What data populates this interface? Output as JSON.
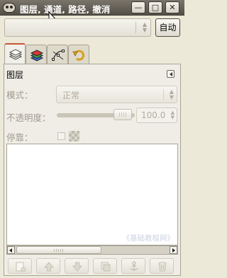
{
  "window": {
    "title": "图层, 通道, 路径, 撤消",
    "minimize_icon": "minimize-icon",
    "maximize_icon": "maximize-icon",
    "close_icon": "close-icon"
  },
  "toolbar": {
    "image_combo_value": "",
    "auto_button": "自动"
  },
  "tabs": [
    {
      "icon": "layers-icon",
      "active": true
    },
    {
      "icon": "channels-icon",
      "active": false
    },
    {
      "icon": "paths-icon",
      "active": false
    },
    {
      "icon": "undo-history-icon",
      "active": false
    }
  ],
  "layers_panel": {
    "title": "图层",
    "mode_label": "模式：",
    "mode_value": "正常",
    "opacity_label": "不透明度：",
    "opacity_value": "100.0",
    "opacity_level_percent": 100,
    "lock_label": "停靠：",
    "watermark": "《基础教程网》"
  },
  "bottom_buttons": [
    {
      "icon": "new-layer-icon"
    },
    {
      "icon": "raise-layer-icon"
    },
    {
      "icon": "lower-layer-icon"
    },
    {
      "icon": "duplicate-layer-icon"
    },
    {
      "icon": "anchor-layer-icon"
    },
    {
      "icon": "delete-layer-icon"
    }
  ],
  "colors": {
    "titlebar": "#5f5a50",
    "active_tab_accent": "#c7563a",
    "disabled_text": "#a19c90"
  }
}
